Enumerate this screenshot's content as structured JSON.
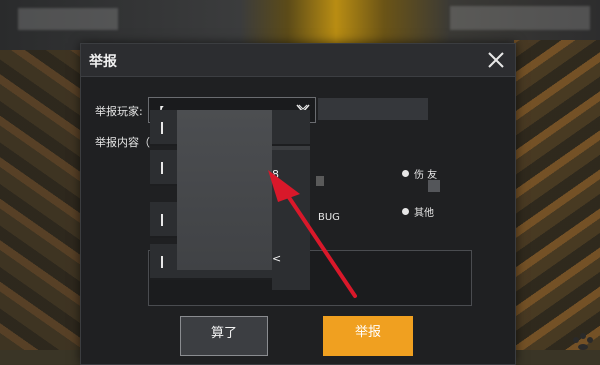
{
  "dialog": {
    "title": "举报",
    "player_label": "举报玩家:",
    "player_value": "【",
    "content_label": "举报内容（",
    "options": [
      {
        "label": "伤  友"
      },
      {
        "label": "其他"
      }
    ],
    "fragment_1": "8",
    "fragment_2": "BUG",
    "buttons": {
      "cancel": "算了",
      "report": "举报"
    }
  },
  "dropdown": {
    "side_glyph": "<",
    "rows": [
      "",
      "",
      "",
      ""
    ]
  },
  "colors": {
    "dialog_bg": "#1f2022",
    "accent": "#f0a020",
    "arrow": "#d9182a"
  },
  "icons": [
    "close-icon",
    "chevron-down-icon",
    "paw-icon"
  ]
}
